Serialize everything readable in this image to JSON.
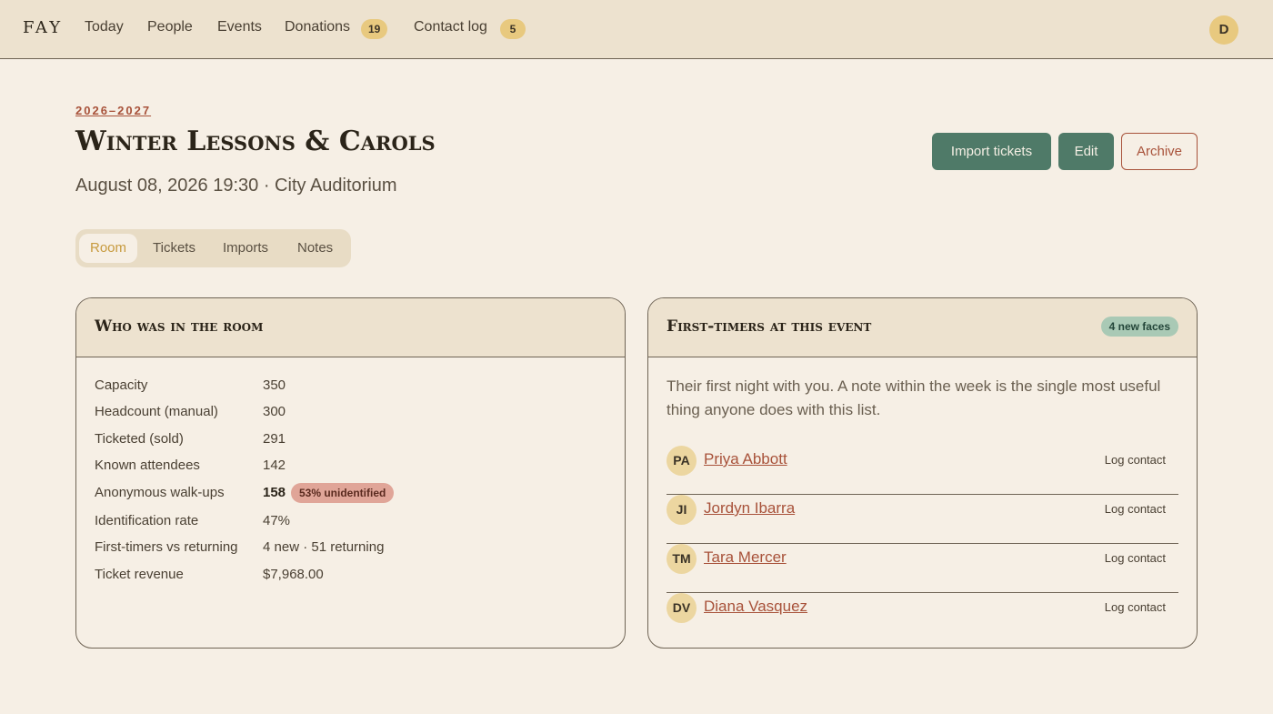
{
  "brand": "FAY",
  "nav": {
    "today": "Today",
    "people": "People",
    "events": "Events",
    "donations": "Donations",
    "donations_count": "19",
    "contact_log": "Contact log",
    "contact_log_count": "5",
    "user_initial": "D"
  },
  "event": {
    "season": "2026–2027",
    "title": "Winter Lessons & Carols",
    "subtitle": "August 08, 2026 19:30 · City Auditorium"
  },
  "actions": {
    "import": "Import tickets",
    "edit": "Edit",
    "archive": "Archive"
  },
  "tabs": [
    "Room",
    "Tickets",
    "Imports",
    "Notes"
  ],
  "room": {
    "title": "Who was in the room",
    "stats": [
      {
        "label": "Capacity",
        "value": "350"
      },
      {
        "label": "Headcount (manual)",
        "value": "300"
      },
      {
        "label": "Ticketed (sold)",
        "value": "291"
      },
      {
        "label": "Known attendees",
        "value": "142"
      },
      {
        "label": "Anonymous walk-ups",
        "value": "158",
        "badge": "53% unidentified"
      },
      {
        "label": "Identification rate",
        "value": "47%"
      },
      {
        "label": "First-timers vs returning",
        "value": "4 new · 51 returning"
      },
      {
        "label": "Ticket revenue",
        "value": "$7,968.00"
      }
    ]
  },
  "first_timers": {
    "title": "First-timers at this event",
    "badge": "4 new faces",
    "intro": "Their first night with you. A note within the week is the single most useful thing anyone does with this list.",
    "log_label": "Log contact",
    "people": [
      {
        "initials": "PA",
        "name": "Priya Abbott"
      },
      {
        "initials": "JI",
        "name": "Jordyn Ibarra"
      },
      {
        "initials": "TM",
        "name": "Tara Mercer"
      },
      {
        "initials": "DV",
        "name": "Diana Vasquez"
      }
    ]
  },
  "colors": {
    "accent_green": "#4f7a68",
    "accent_red": "#a8523a",
    "badge_gold": "#e8c97f",
    "background": "#f6efe5"
  }
}
